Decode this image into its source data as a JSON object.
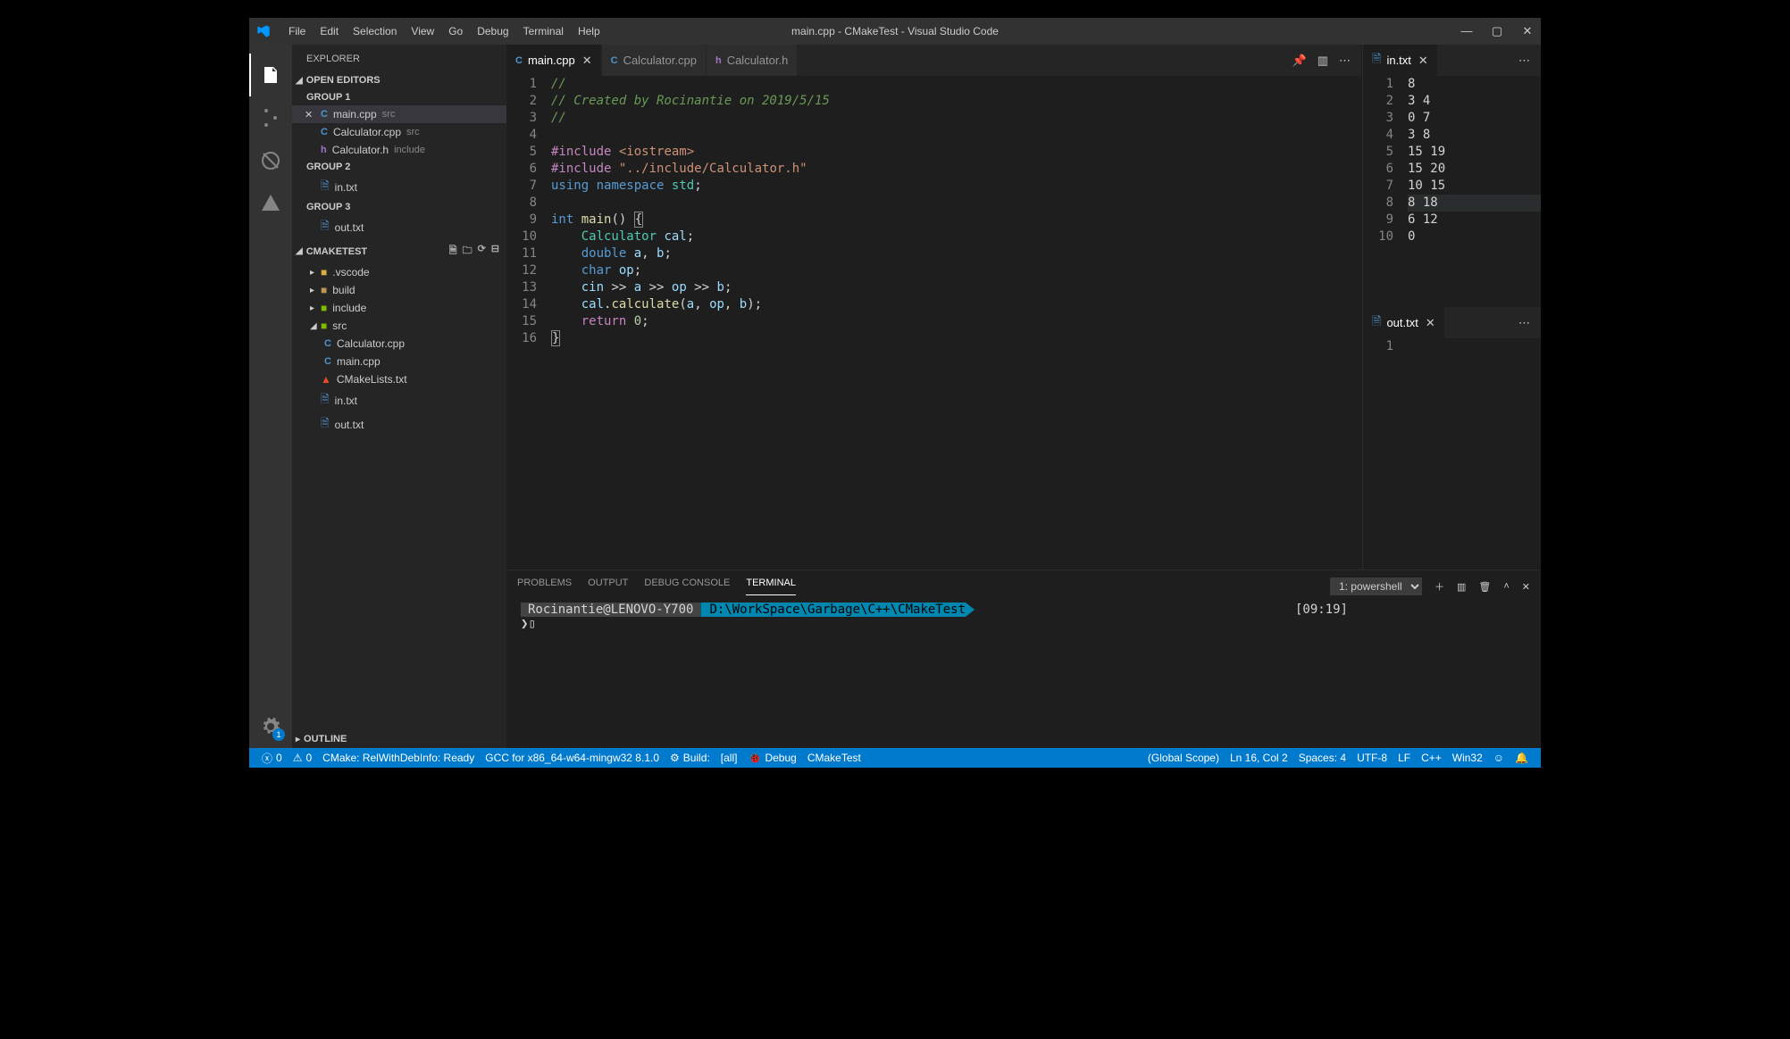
{
  "titlebar": {
    "title": "main.cpp - CMakeTest - Visual Studio Code",
    "menu": {
      "file": "File",
      "edit": "Edit",
      "selection": "Selection",
      "view": "View",
      "go": "Go",
      "debug": "Debug",
      "terminal": "Terminal",
      "help": "Help"
    }
  },
  "sidebar": {
    "title": "EXPLORER",
    "openEditors": "OPEN EDITORS",
    "group1": "GROUP 1",
    "group2": "GROUP 2",
    "group3": "GROUP 3",
    "openItems": {
      "mainCpp": {
        "name": "main.cpp",
        "detail": "src"
      },
      "calcCpp": {
        "name": "Calculator.cpp",
        "detail": "src"
      },
      "calcH": {
        "name": "Calculator.h",
        "detail": "include"
      },
      "inTxt": {
        "name": "in.txt"
      },
      "outTxt": {
        "name": "out.txt"
      }
    },
    "projectName": "CMAKETEST",
    "tree": {
      "vscode": ".vscode",
      "build": "build",
      "include": "include",
      "src": "src",
      "srcFiles": {
        "calcCpp": "Calculator.cpp",
        "mainCpp": "main.cpp"
      },
      "cmakeLists": "CMakeLists.txt",
      "inTxt": "in.txt",
      "outTxt": "out.txt"
    },
    "outline": "OUTLINE"
  },
  "tabs": {
    "main": "main.cpp",
    "calcCpp": "Calculator.cpp",
    "calcH": "Calculator.h",
    "in": "in.txt",
    "out": "out.txt"
  },
  "code": {
    "lines": 16
  },
  "inFile": {
    "lines": [
      "8",
      "3 4",
      "0 7",
      "3 8",
      "15 19",
      "15 20",
      "10 15",
      "8 18",
      "6 12",
      "0"
    ],
    "highlightLine": 8
  },
  "outFile": {
    "lineCount": 1
  },
  "terminal": {
    "tabsLabel": {
      "problems": "PROBLEMS",
      "output": "OUTPUT",
      "debugConsole": "DEBUG CONSOLE",
      "terminal": "TERMINAL"
    },
    "selectLabel": "1: powershell",
    "userHost": "Rocinantie@LENOVO-Y700",
    "cwd": " D:\\WorkSpace\\Garbage\\C++\\CMakeTest ",
    "time": "[09:19]",
    "prompt": "❯"
  },
  "statusbar": {
    "errors": "0",
    "warnings": "0",
    "cmake": "CMake: RelWithDebInfo: Ready",
    "gcc": "GCC for x86_64-w64-mingw32 8.1.0",
    "build": "Build:",
    "all": "[all]",
    "debug": "Debug",
    "target": "CMakeTest",
    "scope": "(Global Scope)",
    "lnCol": "Ln 16, Col 2",
    "spaces": "Spaces: 4",
    "encoding": "UTF-8",
    "eol": "LF",
    "lang": "C++",
    "platform": "Win32"
  },
  "activity": {
    "settingsBadge": "1"
  }
}
